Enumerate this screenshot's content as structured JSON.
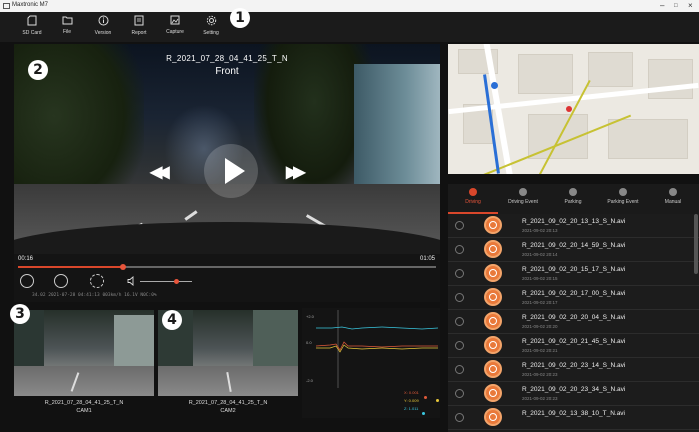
{
  "window": {
    "title": "Maxtronic M7",
    "minimize": "–",
    "maximize": "□",
    "close": "×"
  },
  "toolbar": {
    "items": [
      {
        "label": "SD Card",
        "icon": "sd-card-icon"
      },
      {
        "label": "File",
        "icon": "folder-icon"
      },
      {
        "label": "Version",
        "icon": "info-icon"
      },
      {
        "label": "Report",
        "icon": "report-icon"
      },
      {
        "label": "Capture",
        "icon": "capture-icon"
      },
      {
        "label": "Setting",
        "icon": "gear-icon"
      }
    ]
  },
  "badges": [
    "1",
    "2",
    "3",
    "4"
  ],
  "main_video": {
    "filename": "R_2021_07_28_04_41_25_T_N",
    "camera": "Front",
    "current_time": "00:16",
    "total_time": "01:05",
    "progress": 0.25,
    "volume": 0.7,
    "info_line": "34.02 2021-07-28 04:41:13  003km/h  16.1V  N0C:0%"
  },
  "event_tabs": {
    "active": 0,
    "items": [
      {
        "label": "Driving",
        "color": "#d9472b"
      },
      {
        "label": "Driving Event",
        "color": "#888888"
      },
      {
        "label": "Parking",
        "color": "#888888"
      },
      {
        "label": "Parking Event",
        "color": "#888888"
      },
      {
        "label": "Manual",
        "color": "#888888"
      }
    ]
  },
  "files": [
    {
      "name": "R_2021_09_02_20_13_13_S_N.avi",
      "date": "2021-09-02 20:13"
    },
    {
      "name": "R_2021_09_02_20_14_59_S_N.avi",
      "date": "2021-09-02 20:14"
    },
    {
      "name": "R_2021_09_02_20_15_17_S_N.avi",
      "date": "2021-09-02 20:15"
    },
    {
      "name": "R_2021_09_02_20_17_00_S_N.avi",
      "date": "2021-09-02 20:17"
    },
    {
      "name": "R_2021_09_02_20_20_04_S_N.avi",
      "date": "2021-09-02 20:20"
    },
    {
      "name": "R_2021_09_02_20_21_45_S_N.avi",
      "date": "2021-09-02 20:21"
    },
    {
      "name": "R_2021_09_02_20_23_14_S_N.avi",
      "date": "2021-09-02 20:23"
    },
    {
      "name": "R_2021_09_02_20_23_34_S_N.avi",
      "date": "2021-09-02 20:23"
    },
    {
      "name": "R_2021_09_02_13_38_10_T_N.avi",
      "date": ""
    }
  ],
  "sub_cams": [
    {
      "filename": "R_2021_07_28_04_41_25_T_N",
      "label": "CAM1"
    },
    {
      "filename": "R_2021_07_28_04_41_25_T_N",
      "label": "CAM2"
    }
  ],
  "gsensor": {
    "y_top": "+2.0",
    "y_mid": "0.0",
    "y_bottom": "-2.0",
    "legend": [
      {
        "label": "X: 0.001",
        "color": "#e05a3a"
      },
      {
        "label": "Y: 0.009",
        "color": "#e8c83a"
      },
      {
        "label": "Z: 1.011",
        "color": "#3ac8e0"
      }
    ]
  }
}
